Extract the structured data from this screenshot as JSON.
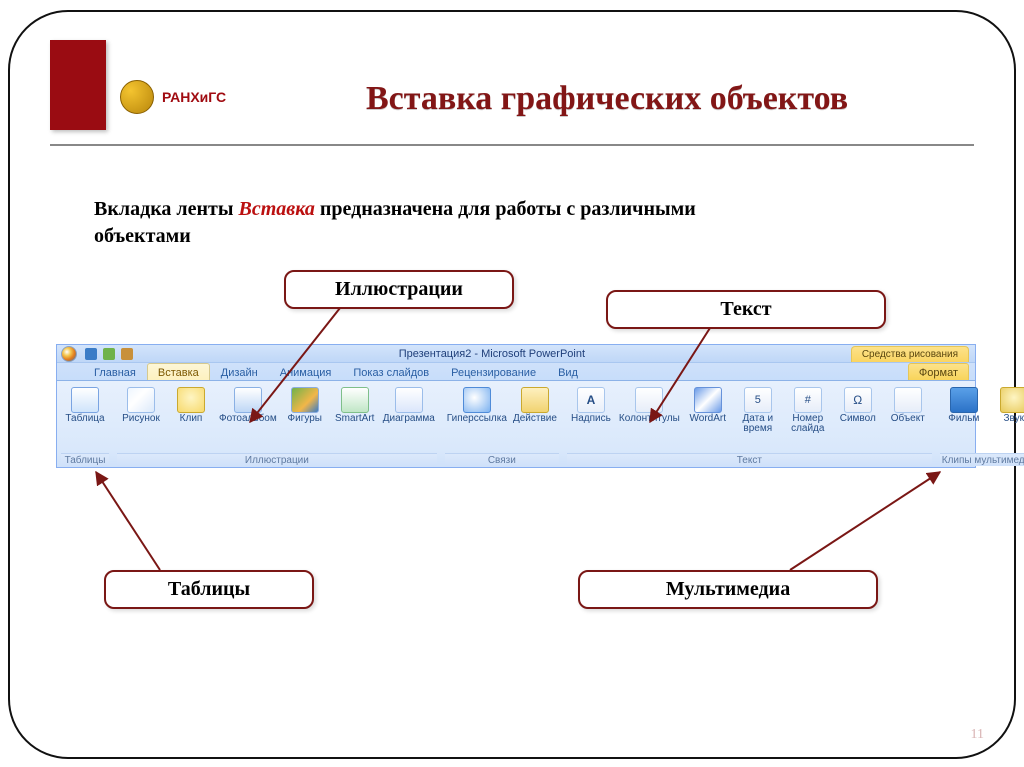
{
  "logo": "РАНХиГС",
  "title": "Вставка графических объектов",
  "intro": {
    "pre": "Вкладка ленты ",
    "em": "Вставка",
    "post": " предназначена для работы  с различными объектами"
  },
  "callouts": {
    "ill": "Иллюстрации",
    "text": "Текст",
    "tables": "Таблицы",
    "multi": "Мультимедиа"
  },
  "ribbon": {
    "docTitle": "Презентация2 - Microsoft PowerPoint",
    "contextTitle": "Средства рисования",
    "tabs": {
      "home": "Главная",
      "insert": "Вставка",
      "design": "Дизайн",
      "anim": "Анимация",
      "show": "Показ слайдов",
      "review": "Рецензирование",
      "view": "Вид",
      "format": "Формат"
    },
    "groups": {
      "tables": {
        "label": "Таблицы",
        "items": {
          "table": "Таблица"
        }
      },
      "ill": {
        "label": "Иллюстрации",
        "items": {
          "pic": "Рисунок",
          "clip": "Клип",
          "album": "Фотоальбом",
          "shapes": "Фигуры",
          "smart": "SmartArt",
          "chart": "Диаграмма"
        }
      },
      "links": {
        "label": "Связи",
        "items": {
          "link": "Гиперссылка",
          "action": "Действие"
        }
      },
      "text": {
        "label": "Текст",
        "items": {
          "textbox": "Надпись",
          "hf": "Колонтитулы",
          "wa": "WordArt",
          "date": "Дата и\nвремя",
          "num": "Номер\nслайда",
          "sym": "Символ",
          "obj": "Объект"
        }
      },
      "media": {
        "label": "Клипы мультимедиа",
        "items": {
          "film": "Фильм",
          "sound": "Звук"
        }
      }
    }
  },
  "page": "11"
}
